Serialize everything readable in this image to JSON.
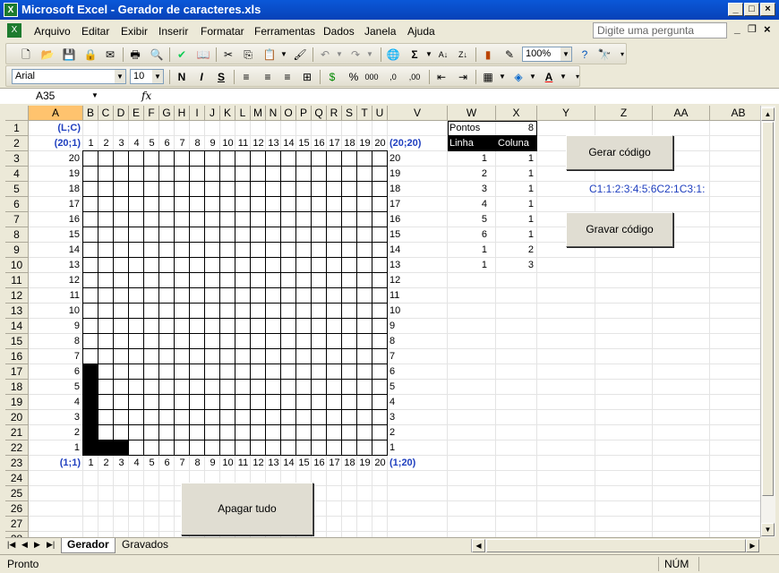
{
  "window": {
    "title": "Microsoft Excel - Gerador de caracteres.xls"
  },
  "menu": [
    "Arquivo",
    "Editar",
    "Exibir",
    "Inserir",
    "Formatar",
    "Ferramentas",
    "Dados",
    "Janela",
    "Ajuda"
  ],
  "help_placeholder": "Digite uma pergunta",
  "toolbar": {
    "zoom": "100%",
    "font": "Arial",
    "size": "10",
    "bold": "N",
    "italic": "I",
    "underline": "S"
  },
  "namebox": "A35",
  "fx": "fx",
  "columns": [
    "A",
    "B",
    "C",
    "D",
    "E",
    "F",
    "G",
    "H",
    "I",
    "J",
    "K",
    "L",
    "M",
    "N",
    "O",
    "P",
    "Q",
    "R",
    "S",
    "T",
    "U",
    "V",
    "W",
    "X",
    "Y",
    "Z",
    "AA",
    "AB"
  ],
  "rows": [
    "1",
    "2",
    "3",
    "4",
    "5",
    "6",
    "7",
    "8",
    "9",
    "10",
    "11",
    "12",
    "13",
    "14",
    "15",
    "16",
    "17",
    "18",
    "19",
    "20",
    "21",
    "22",
    "23",
    "24",
    "25",
    "26",
    "27",
    "28"
  ],
  "grid": {
    "label_lc": "(L;C)",
    "corner_tl": "(20;1)",
    "corner_tr": "(20;20)",
    "corner_bl": "(1;1)",
    "corner_br": "(1;20)",
    "col_numbers": [
      "1",
      "2",
      "3",
      "4",
      "5",
      "6",
      "7",
      "8",
      "9",
      "10",
      "11",
      "12",
      "13",
      "14",
      "15",
      "16",
      "17",
      "18",
      "19",
      "20"
    ],
    "row_numbers": [
      "20",
      "19",
      "18",
      "17",
      "16",
      "15",
      "14",
      "13",
      "12",
      "11",
      "10",
      "9",
      "8",
      "7",
      "6",
      "5",
      "4",
      "3",
      "2",
      "1"
    ],
    "filled": [
      [
        1,
        1
      ],
      [
        2,
        1
      ],
      [
        3,
        1
      ],
      [
        4,
        1
      ],
      [
        5,
        1
      ],
      [
        6,
        1
      ],
      [
        1,
        2
      ],
      [
        1,
        3
      ]
    ]
  },
  "points": {
    "label": "Pontos",
    "value": "8",
    "header_line": "Linha",
    "header_col": "Coluna",
    "lines": [
      "1",
      "2",
      "3",
      "4",
      "5",
      "6",
      "1",
      "1"
    ],
    "cols": [
      "1",
      "1",
      "1",
      "1",
      "1",
      "1",
      "2",
      "3"
    ]
  },
  "buttons": {
    "generate": "Gerar código",
    "save": "Gravar código",
    "clear": "Apagar tudo"
  },
  "code_output": "C1:1:2:3:4:5:6C2:1C3:1:",
  "tabs": [
    "Gerador",
    "Gravados"
  ],
  "status": {
    "left": "Pronto",
    "num": "NÚM"
  }
}
